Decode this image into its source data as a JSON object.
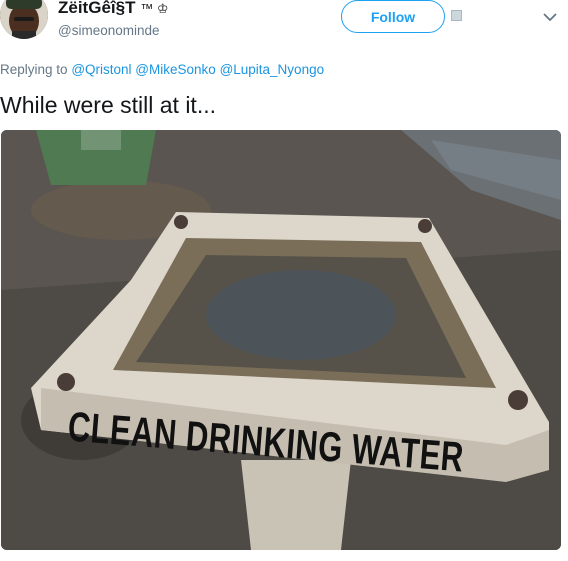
{
  "user": {
    "display_name": "ZëitGêî§T",
    "name_suffix": "™ ♔",
    "handle": "@simeonominde"
  },
  "actions": {
    "follow_label": "Follow"
  },
  "reply": {
    "prefix": "Replying to",
    "mentions": [
      "@Qristonl",
      "@MikeSonko",
      "@Lupita_Nyongo"
    ]
  },
  "tweet": {
    "text": "While were still at it..."
  },
  "image": {
    "stencil_text": "CLEAN DRINKING WATER"
  },
  "colors": {
    "accent": "#1da1f2",
    "mention": "#1b95e0",
    "secondary_text": "#657786"
  }
}
